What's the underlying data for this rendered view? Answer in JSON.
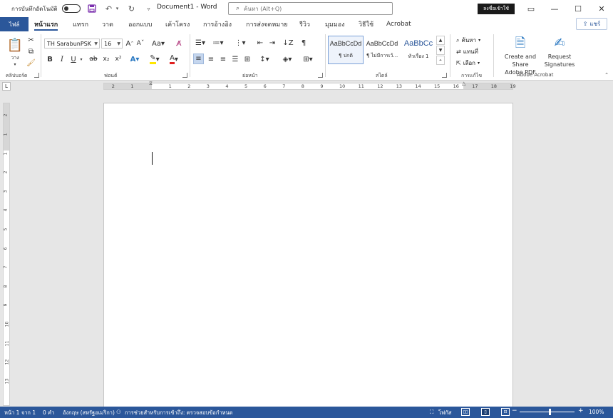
{
  "title_bar": {
    "autosave_label": "การบันทึกอัตโนมัติ",
    "document_title": "Document1  -  Word",
    "search_placeholder": "ค้นหา (Alt+Q)",
    "signin_label": "ลงชื่อเข้าใช้",
    "quick_access_icons": [
      "save-icon",
      "undo-icon",
      "redo-icon",
      "customize-icon"
    ],
    "window_controls": [
      "ribbon-display-icon",
      "minimize-icon",
      "maximize-icon",
      "close-icon"
    ]
  },
  "tabs": {
    "file": "ไฟล์",
    "items": [
      "หน้าแรก",
      "แทรก",
      "วาด",
      "ออกแบบ",
      "เค้าโครง",
      "การอ้างอิง",
      "การส่งจดหมาย",
      "รีวิว",
      "มุมมอง",
      "วิธีใช้",
      "Acrobat"
    ],
    "active": "หน้าแรก",
    "share": "แชร์"
  },
  "ribbon": {
    "clipboard": {
      "paste_label": "วาง",
      "group_label": "คลิปบอร์ด"
    },
    "font": {
      "font_name": "TH SarabunPSK",
      "font_size": "16",
      "group_label": "ฟอนต์"
    },
    "paragraph": {
      "group_label": "ย่อหน้า"
    },
    "styles": {
      "group_label": "สไตล์",
      "items": [
        {
          "sample": "AaBbCcDd",
          "name": "¶ ปกติ"
        },
        {
          "sample": "AaBbCcDd",
          "name": "¶ ไม่มีการเว้..."
        },
        {
          "sample": "AaBbCc",
          "name": "หัวเรื่อง 1"
        }
      ]
    },
    "editing": {
      "find": "ค้นหา",
      "replace": "แทนที่",
      "select": "เลือก",
      "group_label": "การแก้ไข"
    },
    "acrobat": {
      "group_label": "Adobe Acrobat",
      "create_share_line1": "Create and Share",
      "create_share_line2": "Adobe PDF",
      "request_line1": "Request",
      "request_line2": "Signatures"
    }
  },
  "ruler": {
    "h_numbers": [
      "2",
      "1",
      "1",
      "2",
      "3",
      "4",
      "5",
      "6",
      "7",
      "8",
      "9",
      "10",
      "11",
      "12",
      "13",
      "14",
      "15",
      "16",
      "17",
      "18",
      "19"
    ],
    "v_numbers": [
      "2",
      "1",
      "1",
      "2",
      "3",
      "4",
      "5",
      "6",
      "7",
      "8",
      "9",
      "10",
      "11",
      "12",
      "13"
    ]
  },
  "status_bar": {
    "page": "หน้า 1 จาก 1",
    "words": "0 คำ",
    "language": "อังกฤษ (สหรัฐอเมริกา)",
    "accessibility": "การช่วยสำหรับการเข้าถึง: ตรวจสอบข้อกำหนด",
    "focus": "โฟกัส",
    "zoom": "100%",
    "zoom_fraction": 0.55
  },
  "colors": {
    "word_blue": "#2b579a",
    "status_blue": "#2b579a",
    "ribbon_bg": "#ffffff",
    "canvas_bg": "#e6e6e6"
  }
}
